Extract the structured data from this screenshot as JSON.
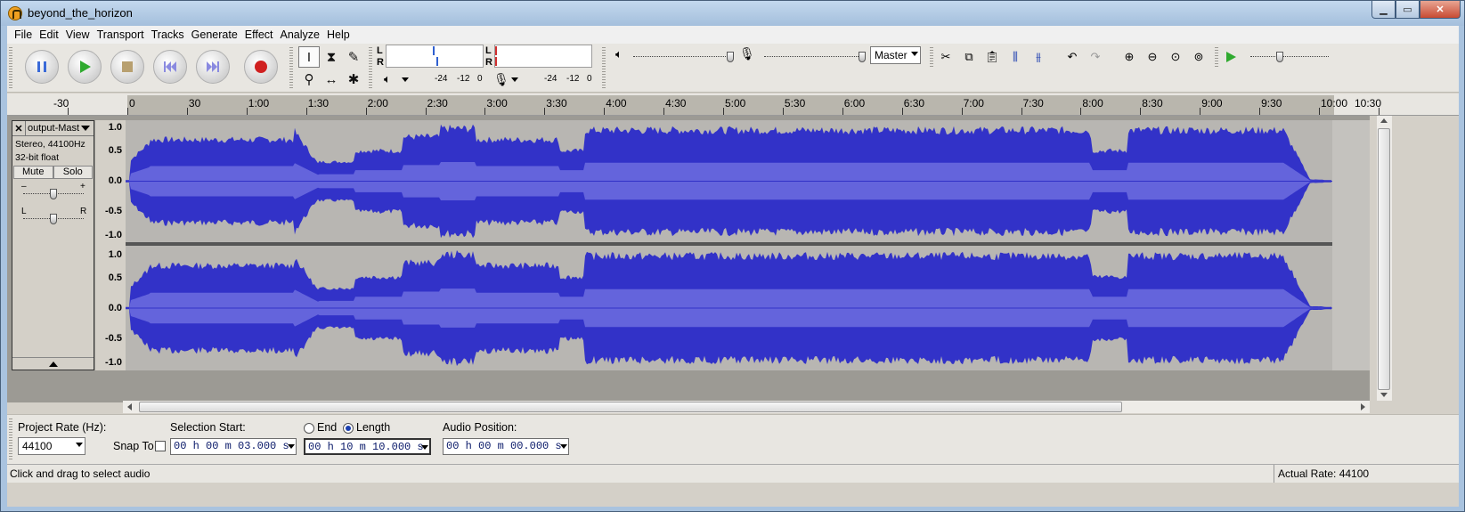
{
  "window": {
    "title": "beyond_the_horizon",
    "buttons": [
      "minimize",
      "maximize",
      "close"
    ]
  },
  "menu": [
    "File",
    "Edit",
    "View",
    "Transport",
    "Tracks",
    "Generate",
    "Effect",
    "Analyze",
    "Help"
  ],
  "meters": {
    "play_L": "L",
    "play_R": "R",
    "rec_L": "L",
    "rec_R": "R",
    "ticks": [
      "-24",
      "-12",
      "0"
    ]
  },
  "mixer": {
    "source": "Master"
  },
  "ruler": {
    "labels": [
      "-30",
      "0",
      "30",
      "1:00",
      "1:30",
      "2:00",
      "2:30",
      "3:00",
      "3:30",
      "4:00",
      "4:30",
      "5:00",
      "5:30",
      "6:00",
      "6:30",
      "7:00",
      "7:30",
      "8:00",
      "8:30",
      "9:00",
      "9:30",
      "10:00",
      "10:30"
    ]
  },
  "track": {
    "name": "output-Mast",
    "info_line1": "Stereo, 44100Hz",
    "info_line2": "32-bit float",
    "mute": "Mute",
    "solo": "Solo",
    "gain_minus": "–",
    "gain_plus": "+",
    "pan_left": "L",
    "pan_right": "R",
    "scale": [
      "1.0",
      "0.5",
      "0.0",
      "-0.5",
      "-1.0"
    ]
  },
  "selection_toolbar": {
    "project_rate_label": "Project Rate (Hz):",
    "project_rate": "44100",
    "snap_to": "Snap To",
    "selection_start_label": "Selection Start:",
    "selection_start": "00 h 00 m 03.000 s",
    "end_label": "End",
    "length_label": "Length",
    "length_value": "00 h 10 m 10.000 s",
    "audio_position_label": "Audio Position:",
    "audio_position": "00 h 00 m 00.000 s"
  },
  "status": {
    "left": "Click and drag to select audio",
    "right": "Actual Rate: 44100"
  }
}
